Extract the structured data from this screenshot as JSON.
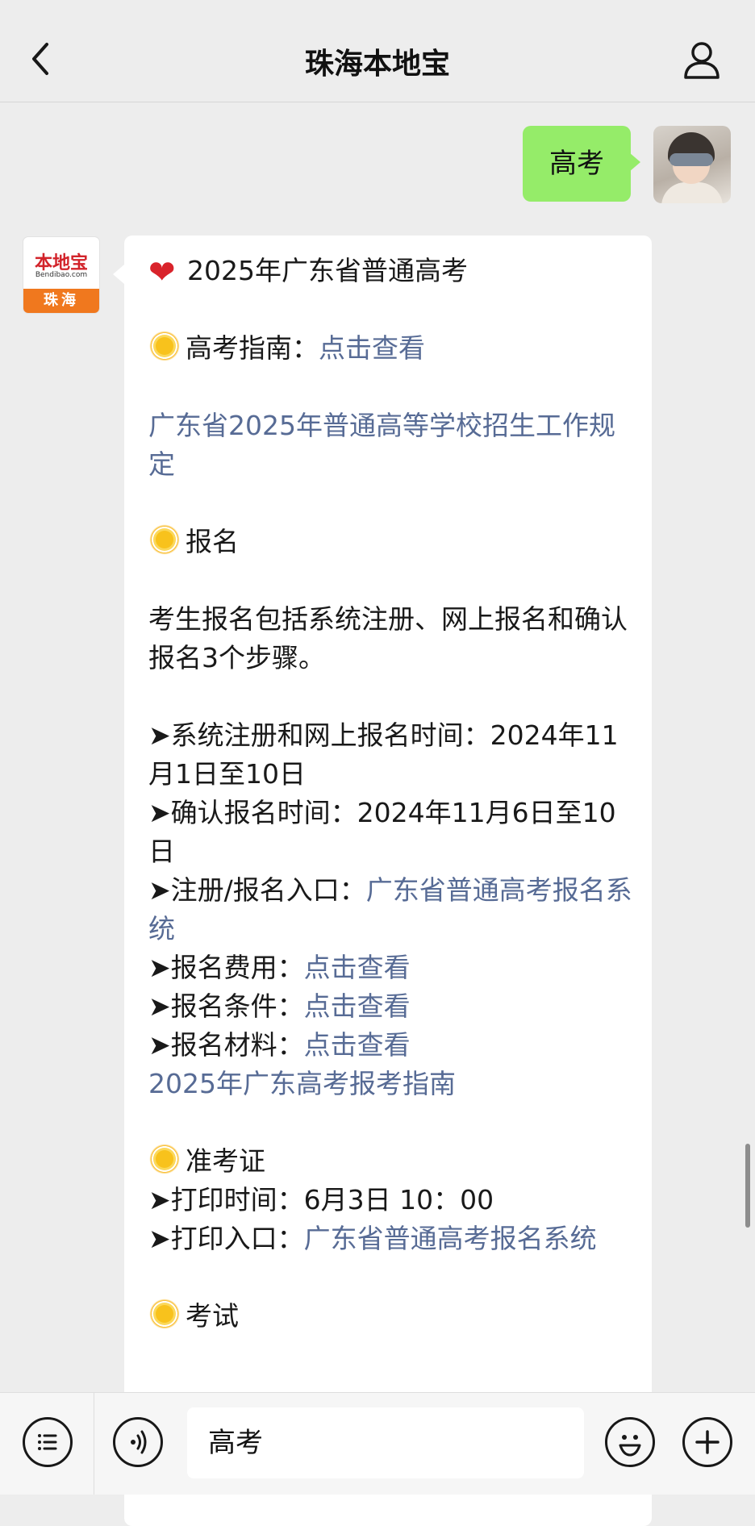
{
  "header": {
    "title": "珠海本地宝"
  },
  "chat": {
    "outgoing": {
      "text": "高考"
    },
    "incoming_avatar": {
      "brand": "本地宝",
      "site": "Bendibao.com",
      "city": "珠海"
    },
    "incoming": {
      "title_line": "2025年广东省普通高考",
      "guide_label": "高考指南：",
      "guide_link": "点击查看",
      "regulation_link": "广东省2025年普通高等学校招生工作规定",
      "section_signup": "报名",
      "signup_desc": "考生报名包括系统注册、网上报名和确认报名3个步骤。",
      "reg_time": "➤系统注册和网上报名时间：2024年11月1日至10日",
      "confirm_time": "➤确认报名时间：2024年11月6日至10日",
      "entry_label": "➤注册/报名入口：",
      "entry_link": "广东省普通高考报名系统",
      "fee_label": "➤报名费用：",
      "fee_link": "点击查看",
      "conditions_label": "➤报名条件：",
      "conditions_link": "点击查看",
      "materials_label": "➤报名材料：",
      "materials_link": "点击查看",
      "guide2_link": "2025年广东高考报考指南",
      "section_admission": "准考证",
      "print_time": "➤打印时间：6月3日 10：00",
      "print_entry_label": "➤打印入口：",
      "print_entry_link": "广东省普通高考报名系统",
      "section_exam": "考试"
    }
  },
  "toolbar": {
    "input_value": "高考"
  },
  "icons": {
    "back": "chevron-left-icon",
    "profile": "person-icon",
    "menu": "list-icon",
    "voice": "voice-icon",
    "emoji": "emoji-icon",
    "plus": "plus-icon"
  },
  "colors": {
    "bubble_out": "#95ec69",
    "link": "#576b95",
    "background": "#ededed"
  }
}
